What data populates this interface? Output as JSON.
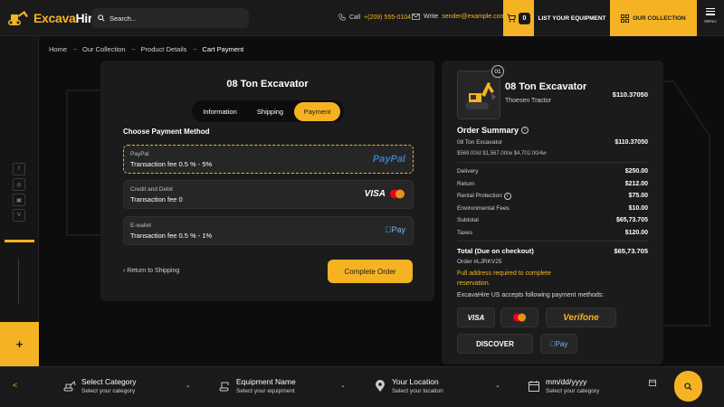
{
  "brand": {
    "name_a": "Excava",
    "name_b": "Hire"
  },
  "header": {
    "search_placeholder": "Search...",
    "call_label": "Call",
    "phone": "+(209) 555-0104",
    "write_label": "Write",
    "email": "sender@example.com",
    "cart_count": "0",
    "list_equipment": "LIST YOUR EQUIPMENT",
    "our_collection": "OUR COLLECTION",
    "menu_label": "MENU"
  },
  "breadcrumb": [
    "Home",
    "Our Collection",
    "Product Details",
    "Cart Payment"
  ],
  "payment": {
    "title": "08 Ton Excavator",
    "tabs": [
      "Information",
      "Shipping",
      "Payment"
    ],
    "choose_label": "Choose Payment Method",
    "options": [
      {
        "name": "PayPal",
        "fee": "Transaction fee 0.5 % - 5%",
        "brand": "PayPal"
      },
      {
        "name": "Credit and Debit",
        "fee": "Transaction fee 0",
        "brand": "VISA"
      },
      {
        "name": "E-wallet",
        "fee": "Transaction fee 0.5 % - 1%",
        "brand": "Pay"
      }
    ],
    "back_label": "Return to Shipping",
    "complete_label": "Complete Order"
  },
  "summary": {
    "qty": "01",
    "product_name": "08 Ton Excavator",
    "product_sub": "Thoesen Tractor",
    "product_price": "$110.37050",
    "title": "Order Summary",
    "item_name": "08 Ton Excavator",
    "item_price": "$110.37050",
    "item_rates": "$569.00/d $1,567.00/w $4,702.00/4w",
    "lines": [
      {
        "label": "Delivery",
        "value": "$250.00"
      },
      {
        "label": "Return",
        "value": "$212.00"
      },
      {
        "label": "Rental Protection",
        "value": "$75.00"
      },
      {
        "label": "Environmental Fees",
        "value": "$10.00"
      },
      {
        "label": "Subtotal",
        "value": "$65,73.705"
      },
      {
        "label": "Taxes",
        "value": "$120.00"
      }
    ],
    "total_label": "Total (Due on checkout)",
    "total_value": "$65,73.705",
    "order_no": "Order #LJRKV25",
    "warning": "Full address required to complete reservation.",
    "accepts": "ExcavaHire US accepts following payment methods:",
    "methods": [
      "VISA",
      "",
      "Verifone",
      "DISCOVER",
      "Pay"
    ]
  },
  "filter": [
    {
      "title": "Select Category",
      "sub": "Select your category"
    },
    {
      "title": "Equipment Name",
      "sub": "Select your equipment"
    },
    {
      "title": "Your Location",
      "sub": "Select your location"
    },
    {
      "title": "mm/dd/yyyy",
      "sub": "Select your category"
    }
  ],
  "colors": {
    "accent": "#f5b324",
    "bg": "#0d0d0d",
    "panel": "#1b1b1b"
  }
}
